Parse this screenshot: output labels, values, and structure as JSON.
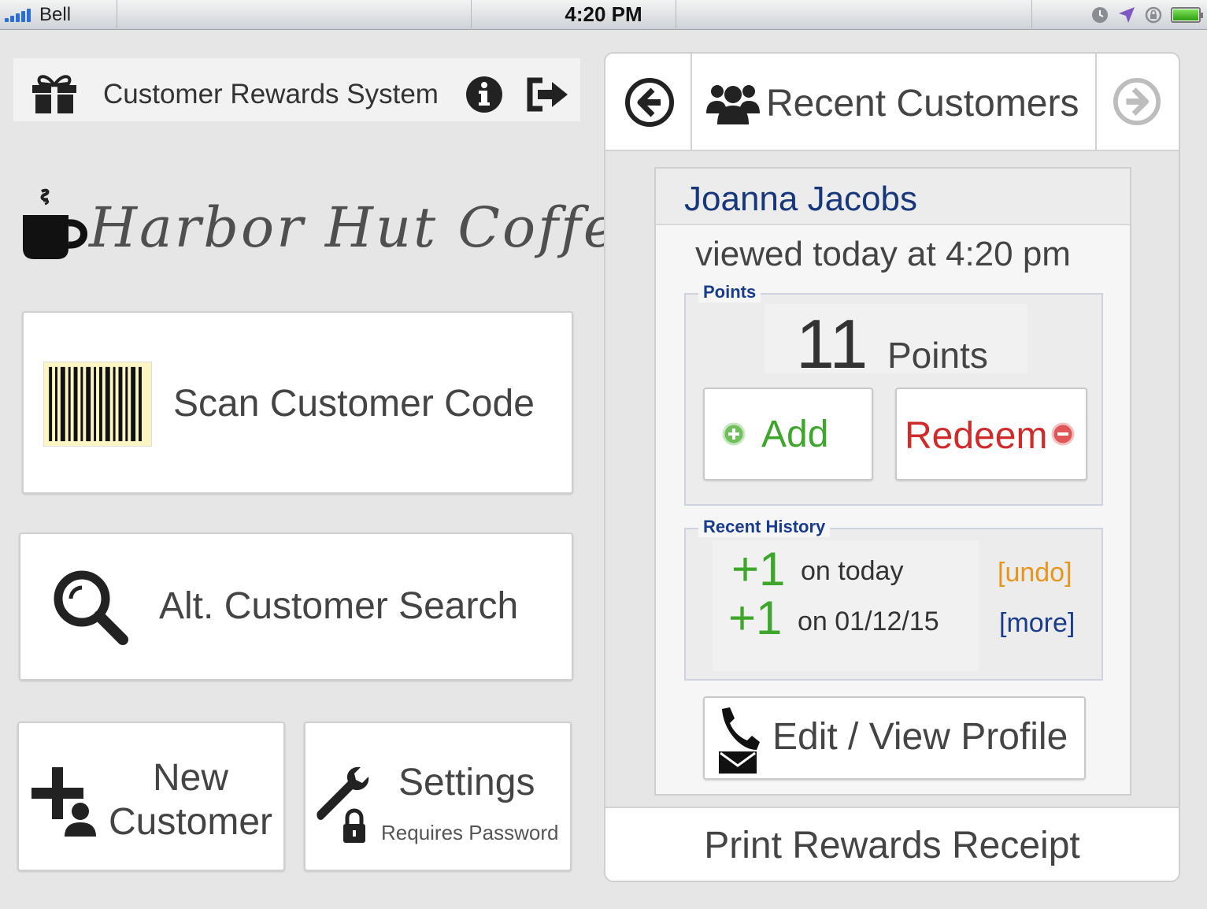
{
  "status_bar": {
    "carrier": "Bell",
    "time": "4:20 PM",
    "icons": [
      "signal-icon",
      "clock-icon",
      "location-icon",
      "rotation-lock-icon",
      "battery-icon"
    ]
  },
  "header": {
    "title": "Customer Rewards System",
    "icons": [
      "gift-icon",
      "info-icon",
      "logout-icon"
    ]
  },
  "logo": {
    "brand": "Harbor Hut Coffee"
  },
  "actions": {
    "scan_label": "Scan Customer Code",
    "search_label": "Alt. Customer Search",
    "new_customer_line1": "New",
    "new_customer_line2": "Customer",
    "settings_label": "Settings",
    "settings_sub": "Requires Password"
  },
  "recent_panel": {
    "title": "Recent Customers",
    "customer": {
      "name": "Joanna Jacobs",
      "viewed": "viewed today at 4:20 pm"
    },
    "points": {
      "legend": "Points",
      "value": "11",
      "unit": "Points",
      "add_label": "Add",
      "redeem_label": "Redeem"
    },
    "history": {
      "legend": "Recent History",
      "entries": [
        {
          "delta": "+1",
          "when": "on today",
          "link": "[undo]"
        },
        {
          "delta": "+1",
          "when": "on 01/12/15",
          "link": "[more]"
        }
      ]
    },
    "profile_label": "Edit / View Profile",
    "print_label": "Print Rewards Receipt"
  },
  "colors": {
    "accent_blue": "#1a3c8c",
    "add_green": "#3fa62c",
    "redeem_red": "#d12a2a",
    "undo_orange": "#e6951d",
    "background": "#e6e6e6"
  }
}
